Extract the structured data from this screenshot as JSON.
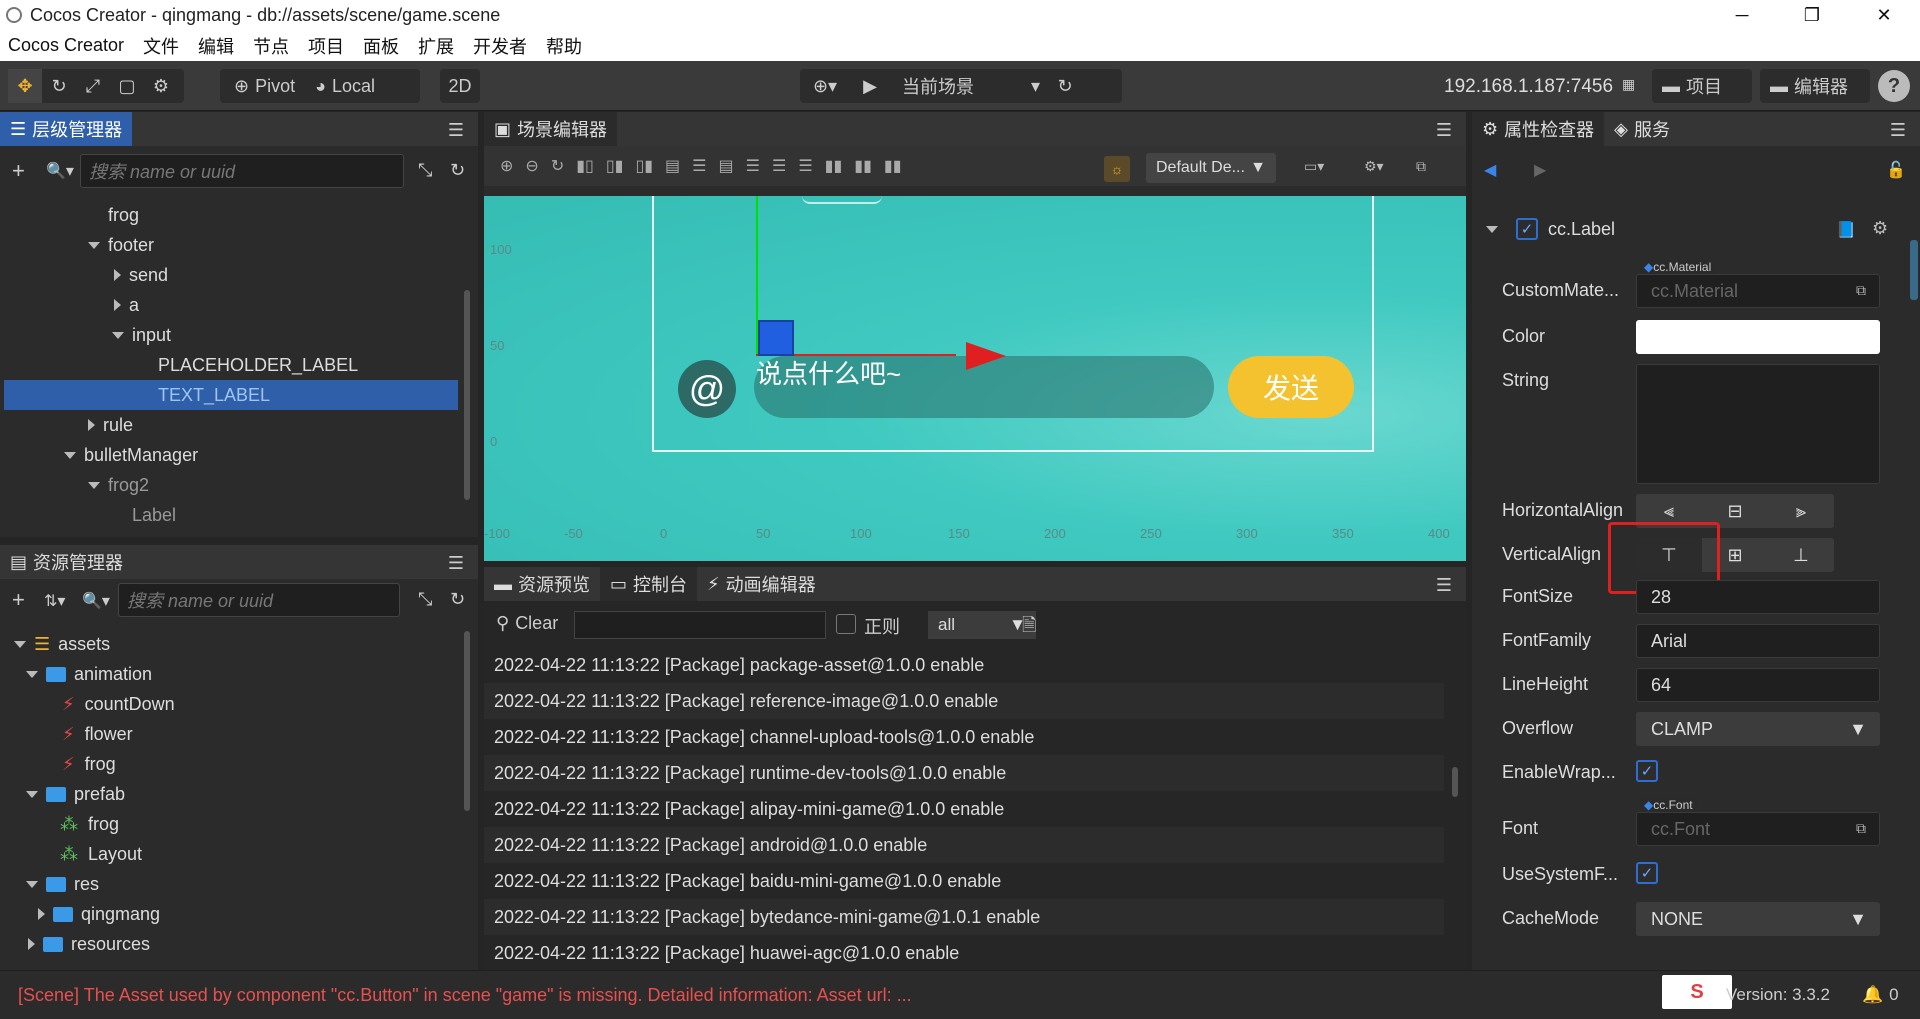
{
  "window": {
    "title": "Cocos Creator - qingmang - db://assets/scene/game.scene",
    "controls": [
      "─",
      "❐",
      "✕"
    ]
  },
  "menu": [
    "Cocos Creator",
    "文件",
    "编辑",
    "节点",
    "项目",
    "面板",
    "扩展",
    "开发者",
    "帮助"
  ],
  "toolbar": {
    "pivot": "Pivot",
    "local": "Local",
    "mode_2d": "2D",
    "scene_select": "当前场景",
    "ip": "192.168.1.187:7456",
    "project_btn": "项目",
    "editor_btn": "编辑器",
    "help": "?"
  },
  "hierarchy": {
    "tab": "层级管理器",
    "search_placeholder": "搜索 name or uuid",
    "nodes": [
      {
        "label": "frog",
        "expander": "none"
      },
      {
        "label": "footer",
        "expander": "down"
      },
      {
        "label": "send",
        "expander": "right"
      },
      {
        "label": "a",
        "expander": "right"
      },
      {
        "label": "input",
        "expander": "down"
      },
      {
        "label": "PLACEHOLDER_LABEL",
        "expander": "none"
      },
      {
        "label": "TEXT_LABEL",
        "expander": "none",
        "selected": true
      },
      {
        "label": "rule",
        "expander": "right"
      },
      {
        "label": "bulletManager",
        "expander": "down"
      },
      {
        "label": "frog2",
        "expander": "down",
        "dim": true
      },
      {
        "label": "Label",
        "expander": "none",
        "dim": true
      }
    ]
  },
  "assets": {
    "tab": "资源管理器",
    "search_placeholder": "搜索 name or uuid",
    "items": [
      {
        "label": "assets",
        "icon": "db"
      },
      {
        "label": "animation",
        "icon": "folder"
      },
      {
        "label": "countDown",
        "icon": "anim"
      },
      {
        "label": "flower",
        "icon": "anim"
      },
      {
        "label": "frog",
        "icon": "anim"
      },
      {
        "label": "prefab",
        "icon": "folder"
      },
      {
        "label": "frog",
        "icon": "prefab"
      },
      {
        "label": "Layout",
        "icon": "prefab"
      },
      {
        "label": "res",
        "icon": "folder"
      },
      {
        "label": "qingmang",
        "icon": "folder"
      },
      {
        "label": "resources",
        "icon": "folder"
      }
    ]
  },
  "scene_editor": {
    "tab": "场景编辑器",
    "camera_select": "Default De...",
    "y_ticks": [
      "100",
      "50",
      "0"
    ],
    "x_ticks": [
      "-100",
      "-50",
      "0",
      "50",
      "100",
      "150",
      "200",
      "250",
      "300",
      "350",
      "400"
    ],
    "game_input_text": "说点什么吧~",
    "send_button": "发送",
    "at_symbol": "@"
  },
  "console": {
    "tabs": [
      "资源预览",
      "控制台",
      "动画编辑器"
    ],
    "clear": "Clear",
    "regex_label": "正则",
    "level_select": "all",
    "logs": [
      "2022-04-22 11:13:22 [Package] package-asset@1.0.0 enable",
      "2022-04-22 11:13:22 [Package] reference-image@1.0.0 enable",
      "2022-04-22 11:13:22 [Package] channel-upload-tools@1.0.0 enable",
      "2022-04-22 11:13:22 [Package] runtime-dev-tools@1.0.0 enable",
      "2022-04-22 11:13:22 [Package] alipay-mini-game@1.0.0 enable",
      "2022-04-22 11:13:22 [Package] android@1.0.0 enable",
      "2022-04-22 11:13:22 [Package] baidu-mini-game@1.0.0 enable",
      "2022-04-22 11:13:22 [Package] bytedance-mini-game@1.0.1 enable",
      "2022-04-22 11:13:22 [Package] huawei-agc@1.0.0 enable"
    ]
  },
  "inspector": {
    "tab": "属性检查器",
    "tab2": "服务",
    "component": "cc.Label",
    "custom_material_label": "CustomMate...",
    "material_type": "cc.Material",
    "material_placeholder": "cc.Material",
    "color_label": "Color",
    "string_label": "String",
    "halign_label": "HorizontalAlign",
    "valign_label": "VerticalAlign",
    "fontsize_label": "FontSize",
    "fontsize": "28",
    "fontfamily_label": "FontFamily",
    "fontfamily": "Arial",
    "lineheight_label": "LineHeight",
    "lineheight": "64",
    "overflow_label": "Overflow",
    "overflow": "CLAMP",
    "enablewrap_label": "EnableWrap...",
    "font_label": "Font",
    "font_type": "cc.Font",
    "font_placeholder": "cc.Font",
    "usesystemfont_label": "UseSystemF...",
    "cachemode_label": "CacheMode",
    "cachemode": "NONE",
    "color_value": "#ffffff"
  },
  "statusbar": {
    "error": "[Scene] The Asset used by component \"cc.Button\" in scene \"game\" is missing. Detailed information: Asset url: ...",
    "version": "Version: 3.3.2",
    "notifications": "0"
  },
  "colors": {
    "accent": "#2e5fa8",
    "highlight_box": "#e02020",
    "scene_bg": "#3fc9c0",
    "send_btn": "#f3c22e",
    "error_text": "#e85050"
  }
}
